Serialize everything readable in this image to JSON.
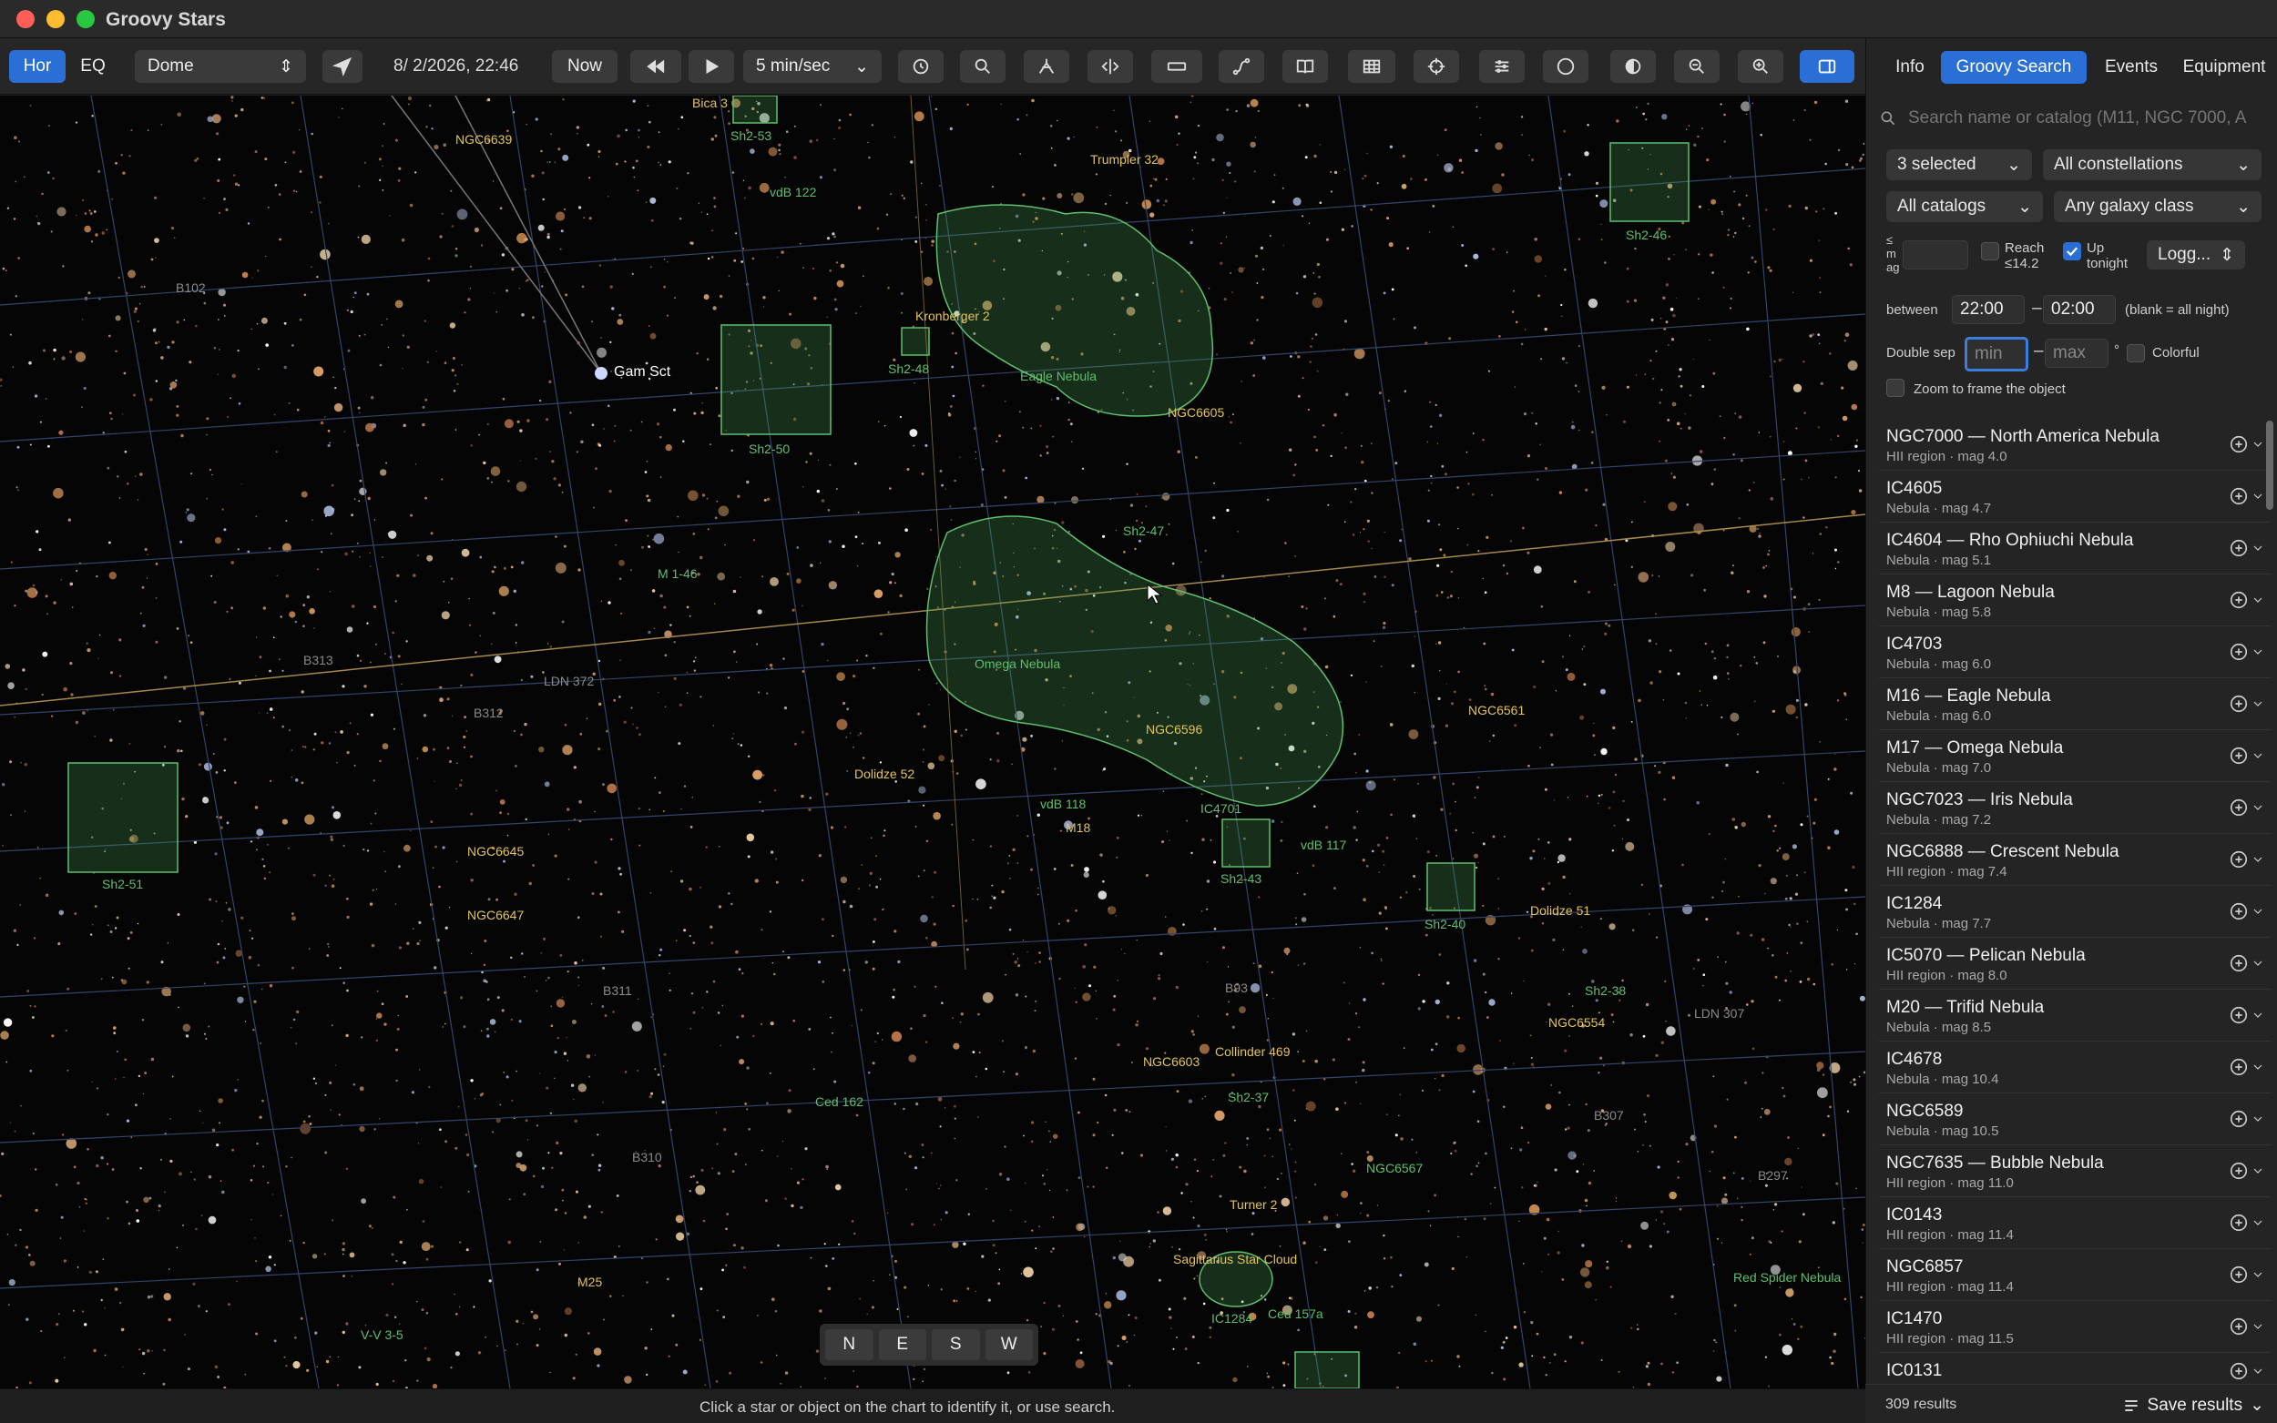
{
  "window": {
    "title": "Groovy Stars"
  },
  "toolbar": {
    "hor": "Hor",
    "eq": "EQ",
    "mount": "Dome",
    "datetime": "8/  2/2026, 22:46",
    "now": "Now",
    "speed": "5 min/sec",
    "icons": [
      "locate-arrow-icon",
      "rewind-icon",
      "play-icon",
      "history-icon",
      "search-icon",
      "telescope-icon",
      "flip-icon",
      "ruler-icon",
      "path-icon",
      "book-icon",
      "table-icon",
      "crosshair-icon",
      "sliders-icon",
      "dots-icon",
      "night-mode-icon",
      "zoom-out-icon",
      "zoom-in-icon",
      "sidebar-toggle-icon"
    ]
  },
  "sky": {
    "labels": [
      {
        "t": "Gam Sct",
        "c": "w"
      },
      {
        "t": "NGC6639",
        "c": "y"
      },
      {
        "t": "Bica 3",
        "c": "y"
      },
      {
        "t": "Sh2-53",
        "c": "g"
      },
      {
        "t": "vdB 122",
        "c": "g"
      },
      {
        "t": "Trumpler 32",
        "c": "y"
      },
      {
        "t": "Sh2-46",
        "c": "g"
      },
      {
        "t": "B102",
        "c": "gr"
      },
      {
        "t": "Kronberger 2",
        "c": "y"
      },
      {
        "t": "Sh2-48",
        "c": "g"
      },
      {
        "t": "Eagle Nebula",
        "c": "g"
      },
      {
        "t": "NGC6605",
        "c": "y"
      },
      {
        "t": "Sh2-50",
        "c": "g"
      },
      {
        "t": "Sh2-47",
        "c": "g"
      },
      {
        "t": "M 1-46",
        "c": "g"
      },
      {
        "t": "B313",
        "c": "gr"
      },
      {
        "t": "LDN 372",
        "c": "gr"
      },
      {
        "t": "B312",
        "c": "gr"
      },
      {
        "t": "Omega Nebula",
        "c": "g"
      },
      {
        "t": "NGC6561",
        "c": "y"
      },
      {
        "t": "NGC6596",
        "c": "y"
      },
      {
        "t": "Dolidze 52",
        "c": "y"
      },
      {
        "t": "vdB 118",
        "c": "g"
      },
      {
        "t": "M18",
        "c": "y"
      },
      {
        "t": "IC4701",
        "c": "g"
      },
      {
        "t": "vdB 117",
        "c": "g"
      },
      {
        "t": "NGC6645",
        "c": "y"
      },
      {
        "t": "Sh2-43",
        "c": "g"
      },
      {
        "t": "Sh2-51",
        "c": "g"
      },
      {
        "t": "NGC6647",
        "c": "y"
      },
      {
        "t": "Sh2-40",
        "c": "g"
      },
      {
        "t": "Dolidze 51",
        "c": "y"
      },
      {
        "t": "B311",
        "c": "gr"
      },
      {
        "t": "B93",
        "c": "gr"
      },
      {
        "t": "Sh2-38",
        "c": "g"
      },
      {
        "t": "LDN 307",
        "c": "gr"
      },
      {
        "t": "NGC6554",
        "c": "y"
      },
      {
        "t": "Collinder 469",
        "c": "y"
      },
      {
        "t": "NGC6603",
        "c": "y"
      },
      {
        "t": "Ced 162",
        "c": "g"
      },
      {
        "t": "Sh2-37",
        "c": "g"
      },
      {
        "t": "B307",
        "c": "gr"
      },
      {
        "t": "B310",
        "c": "gr"
      },
      {
        "t": "NGC6567",
        "c": "g"
      },
      {
        "t": "B297",
        "c": "gr"
      },
      {
        "t": "Turner 2",
        "c": "y"
      },
      {
        "t": "Sagittarius Star Cloud",
        "c": "y"
      },
      {
        "t": "M25",
        "c": "y"
      },
      {
        "t": "Red Spider Nebula",
        "c": "g"
      },
      {
        "t": "V-V 3-5",
        "c": "g"
      },
      {
        "t": "IC1284",
        "c": "g"
      },
      {
        "t": "Ced 157a",
        "c": "g"
      }
    ]
  },
  "compass": [
    "N",
    "E",
    "S",
    "W"
  ],
  "status": "Click a star or object on the chart to identify it, or use search.",
  "panel": {
    "tabs": [
      "Info",
      "Groovy Search",
      "Events",
      "Equipment"
    ],
    "search_placeholder": "Search name or catalog (M11, NGC 7000, A",
    "filters": {
      "types": "3 selected",
      "constellations": "All constellations",
      "catalogs": "All catalogs",
      "galaxy": "Any galaxy class",
      "mag_label": "≤\nm\nag",
      "reach_label": "Reach ≤14.2",
      "up_label": "Up tonight",
      "sort": "Logg...",
      "between": "between",
      "from": "22:00",
      "to": "02:00",
      "blank": "(blank = all night)",
      "dsep": "Double sep",
      "min": "min",
      "max": "max",
      "deg": "°",
      "colorful": "Colorful",
      "zoom": "Zoom to frame the object",
      "dash": "–"
    },
    "results": [
      {
        "name": "NGC7000 — North America Nebula",
        "sub": "HII region · mag 4.0"
      },
      {
        "name": "IC4605",
        "sub": "Nebula · mag 4.7"
      },
      {
        "name": "IC4604 — Rho Ophiuchi Nebula",
        "sub": "Nebula · mag 5.1"
      },
      {
        "name": "M8 — Lagoon Nebula",
        "sub": "Nebula · mag 5.8"
      },
      {
        "name": "IC4703",
        "sub": "Nebula · mag 6.0"
      },
      {
        "name": "M16 — Eagle Nebula",
        "sub": "Nebula · mag 6.0"
      },
      {
        "name": "M17 — Omega Nebula",
        "sub": "Nebula · mag 7.0"
      },
      {
        "name": "NGC7023 — Iris Nebula",
        "sub": "Nebula · mag 7.2"
      },
      {
        "name": "NGC6888 — Crescent Nebula",
        "sub": "HII region · mag 7.4"
      },
      {
        "name": "IC1284",
        "sub": "Nebula · mag 7.7"
      },
      {
        "name": "IC5070 — Pelican Nebula",
        "sub": "HII region · mag 8.0"
      },
      {
        "name": "M20 — Trifid Nebula",
        "sub": "Nebula · mag 8.5"
      },
      {
        "name": "IC4678",
        "sub": "Nebula · mag 10.4"
      },
      {
        "name": "NGC6589",
        "sub": "Nebula · mag 10.5"
      },
      {
        "name": "NGC7635 — Bubble Nebula",
        "sub": "HII region · mag 11.0"
      },
      {
        "name": "IC0143",
        "sub": "HII region · mag 11.4"
      },
      {
        "name": "NGC6857",
        "sub": "HII region · mag 11.4"
      },
      {
        "name": "IC1470",
        "sub": "HII region · mag 11.5"
      },
      {
        "name": "IC0131",
        "sub": ""
      }
    ],
    "count": "309 results",
    "save": "Save results"
  },
  "colors": {
    "accent": "#2a6fd6",
    "nebula": "#5fbf6e",
    "label_yellow": "#e3c45a"
  }
}
